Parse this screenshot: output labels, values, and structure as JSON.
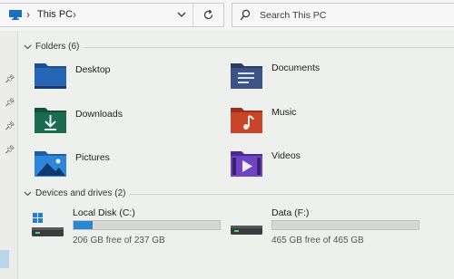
{
  "address": {
    "location": "This PC"
  },
  "search": {
    "placeholder": "Search This PC"
  },
  "sections": {
    "folders_title": "Folders (6)",
    "drives_title": "Devices and drives (2)"
  },
  "folders": [
    {
      "label": "Desktop",
      "icon": "desktop-folder-icon"
    },
    {
      "label": "Documents",
      "icon": "documents-folder-icon"
    },
    {
      "label": "Downloads",
      "icon": "downloads-folder-icon"
    },
    {
      "label": "Music",
      "icon": "music-folder-icon"
    },
    {
      "label": "Pictures",
      "icon": "pictures-folder-icon"
    },
    {
      "label": "Videos",
      "icon": "videos-folder-icon"
    }
  ],
  "drives": [
    {
      "name": "Local Disk (C:)",
      "free_text": "206 GB free of 237 GB",
      "used_fraction": 0.13,
      "icon": "windows-drive-icon"
    },
    {
      "name": "Data (F:)",
      "free_text": "465 GB free of 465 GB",
      "used_fraction": 0.0,
      "icon": "hard-drive-icon"
    }
  ],
  "colors": {
    "accent": "#2a86d1",
    "folder_blue": "#1f5fa8"
  }
}
